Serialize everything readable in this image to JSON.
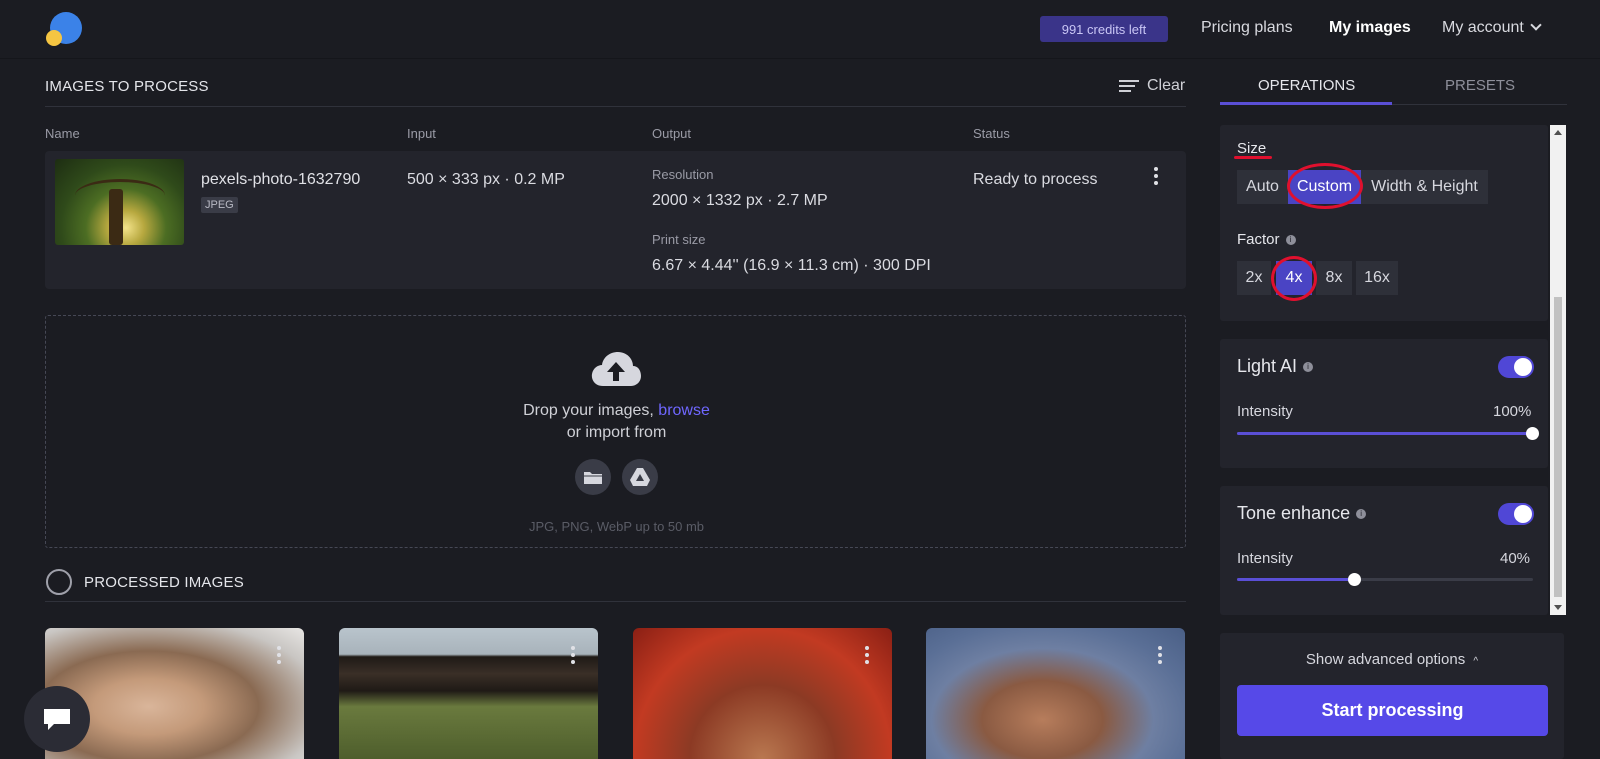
{
  "header": {
    "credits": "991 credits left",
    "nav": [
      "Pricing plans",
      "My images",
      "My account"
    ]
  },
  "queue": {
    "title": "IMAGES TO PROCESS",
    "clear_label": "Clear",
    "columns": [
      "Name",
      "Input",
      "Output",
      "Status"
    ],
    "item": {
      "name": "pexels-photo-1632790",
      "format": "JPEG",
      "input": "500 × 333 px · 0.2 MP",
      "resolution_label": "Resolution",
      "resolution": "2000 × 1332 px · 2.7 MP",
      "print_label": "Print size",
      "print": "6.67 × 4.44'' (16.9 × 11.3 cm) · 300 DPI",
      "status": "Ready to process"
    }
  },
  "dropzone": {
    "text": "Drop your images,",
    "link": "browse",
    "import_text": "or import from",
    "hint": "JPG, PNG, WebP up to 50 mb"
  },
  "processed": {
    "title": "PROCESSED IMAGES"
  },
  "panel": {
    "tabs": [
      "OPERATIONS",
      "PRESETS"
    ],
    "size": {
      "label": "Size",
      "options": [
        "Auto",
        "Custom",
        "Width & Height"
      ],
      "selected": "Custom"
    },
    "factor": {
      "label": "Factor",
      "options": [
        "2x",
        "4x",
        "8x",
        "16x"
      ],
      "selected": "4x"
    },
    "light_ai": {
      "label": "Light AI",
      "enabled": true,
      "intensity_label": "Intensity",
      "intensity": "100%"
    },
    "tone": {
      "label": "Tone enhance",
      "enabled": true,
      "intensity_label": "Intensity",
      "intensity": "40%"
    },
    "advanced": "Show advanced options",
    "start": "Start processing"
  },
  "colors": {
    "accent": "#5649e8",
    "annotation": "#e0102e",
    "background": "#1b1c22"
  }
}
